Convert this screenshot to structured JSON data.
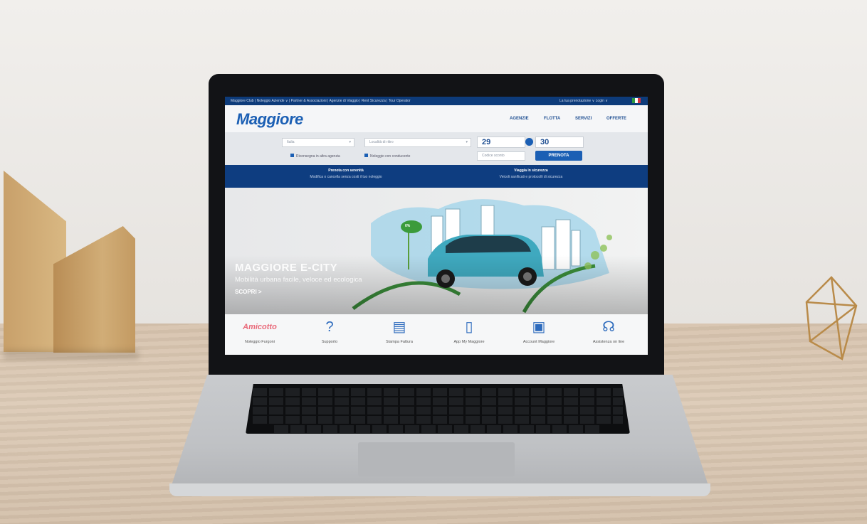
{
  "site": {
    "topbar_left": "Maggiore Club | Noleggio Aziende ∨ | Partner & Associazioni | Agenzie di Viaggio | Rent Sicurezza | Tour Operator",
    "topbar_right": "La tua prenotazione ∨  Login ∨",
    "logo": "Maggiore",
    "nav": [
      "AGENZIE",
      "FLOTTA",
      "SERVIZI",
      "OFFERTE"
    ],
    "search": {
      "pickup_city": "Italia",
      "pickup_placeholder": "Località di ritiro",
      "date_start_day": "29",
      "date_end_day": "30",
      "checkbox_1": "Riconsegna in altra agenzia",
      "checkbox_2": "Noleggio con conducente",
      "promo_placeholder": "Codice sconto",
      "book_button": "PRENOTA"
    },
    "banner": {
      "left_title": "Prenota con serenità",
      "left_text": "Modifica o cancella senza costi il tuo noleggio",
      "right_title": "Viaggia in sicurezza",
      "right_text": "Veicoli sanificati e protocolli di sicurezza"
    },
    "hero": {
      "title": "MAGGIORE E-CITY",
      "subtitle": "Mobilità urbana facile, veloce ed ecologica",
      "cta": "SCOPRI >",
      "badge": "0%"
    },
    "tiles": [
      {
        "icon": "amicotto-logo",
        "label": "Noleggio Furgoni"
      },
      {
        "icon": "question-icon",
        "label": "Supporto"
      },
      {
        "icon": "invoice-icon",
        "label": "Stampa Fattura"
      },
      {
        "icon": "smartphone-icon",
        "label": "App My Maggiore"
      },
      {
        "icon": "account-icon",
        "label": "Account Maggiore"
      },
      {
        "icon": "headset-icon",
        "label": "Assistenza on line"
      }
    ]
  },
  "colors": {
    "brand_blue": "#1b5fb4",
    "navy": "#0e3d80",
    "car_teal": "#3fa9bf"
  }
}
